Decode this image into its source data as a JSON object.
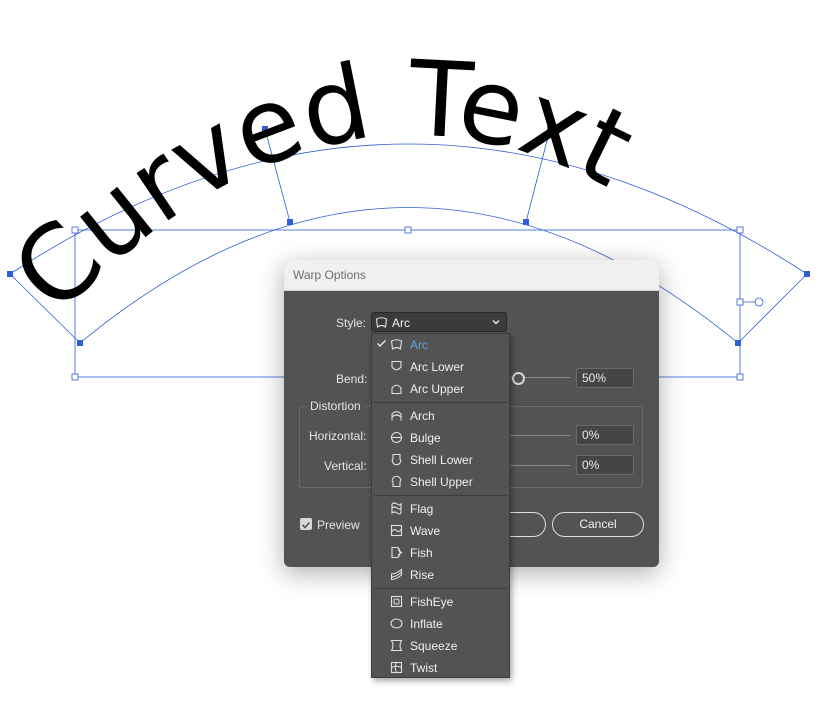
{
  "artwork": {
    "text": "Curved Text",
    "text_color": "#000000",
    "guide_color": "#2e5fd6"
  },
  "dialog": {
    "title": "Warp Options",
    "style_label": "Style:",
    "style_value": "Arc",
    "bend_label": "Bend:",
    "bend_value": "50%",
    "distortion_label": "Distortion",
    "horizontal_label": "Horizontal:",
    "horizontal_value": "0%",
    "vertical_label": "Vertical:",
    "vertical_value": "0%",
    "preview_label": "Preview",
    "preview_checked": true,
    "cancel_label": "Cancel",
    "ok_label": ""
  },
  "menu": {
    "selected": "Arc",
    "selected_color": "#5aa0f0",
    "items": [
      {
        "label": "Arc",
        "icon": "arc-icon"
      },
      {
        "label": "Arc Lower",
        "icon": "arc-lower-icon"
      },
      {
        "label": "Arc Upper",
        "icon": "arc-upper-icon"
      },
      {
        "label": "Arch",
        "icon": "arch-icon"
      },
      {
        "label": "Bulge",
        "icon": "bulge-icon"
      },
      {
        "label": "Shell Lower",
        "icon": "shell-lower-icon"
      },
      {
        "label": "Shell Upper",
        "icon": "shell-upper-icon"
      },
      {
        "label": "Flag",
        "icon": "flag-icon"
      },
      {
        "label": "Wave",
        "icon": "wave-icon"
      },
      {
        "label": "Fish",
        "icon": "fish-icon"
      },
      {
        "label": "Rise",
        "icon": "rise-icon"
      },
      {
        "label": "FishEye",
        "icon": "fisheye-icon"
      },
      {
        "label": "Inflate",
        "icon": "inflate-icon"
      },
      {
        "label": "Squeeze",
        "icon": "squeeze-icon"
      },
      {
        "label": "Twist",
        "icon": "twist-icon"
      }
    ]
  }
}
